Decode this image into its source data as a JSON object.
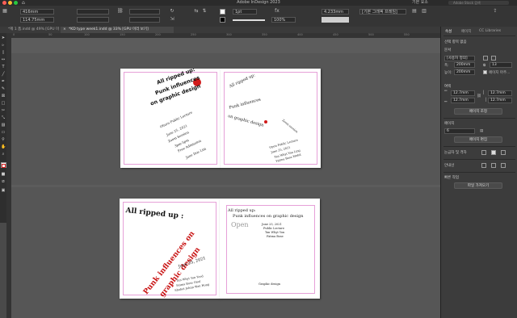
{
  "app": {
    "title": "Adobe InDesign 2023",
    "workspace": "기본 요소",
    "search_placeholder": "Adobe Stock 검색"
  },
  "controlbar": {
    "x_field": "416mm",
    "y_field": "114.75mm",
    "stroke_weight": "1pt",
    "opacity": "100%",
    "dimension": "4.233mm",
    "frame_style": "[기본 그래픽 프레임]"
  },
  "tabs": [
    {
      "label": "*제 1 폼.indd @ 49% [GPU 미리 보기]",
      "active": false
    },
    {
      "label": "*KD type week1.indd @ 33% [GPU 미리 보기]",
      "active": true
    }
  ],
  "ruler_ticks": [
    "0",
    "50",
    "100",
    "150",
    "200",
    "250",
    "300",
    "350",
    "400",
    "450",
    "500",
    "550"
  ],
  "panel": {
    "tabs": [
      "속성",
      "페이지",
      "CC Libraries"
    ],
    "no_selection": "선택 항목 없음",
    "document_section": "문서",
    "preset": "[사용자 정의]",
    "width_label": "폭:",
    "width_value": "200mm",
    "height_label": "높이:",
    "height_value": "200mm",
    "pages_count": "13",
    "facing_pages": "페이지 마주...",
    "margins_section": "여백",
    "margin_top": "12.7mm",
    "margin_bottom": "12.7mm",
    "margin_left": "12.7mm",
    "margin_right": "12.7mm",
    "margins_btn": "페이지 조정",
    "page_section": "페이지",
    "page_value": "6",
    "page_edit_btn": "페이지 편집",
    "rulers_section": "눈금자 및 격자",
    "guides_section": "안내선",
    "quick_actions": "빠른 작업",
    "import_btn": "파일 가져오기"
  },
  "page1": {
    "title_lines": [
      "All ripped up:",
      "Punk influences",
      "on graphic design"
    ],
    "info_lines": [
      "Ohuro Public Lecture",
      "June 25, 2021",
      "Zoom Session",
      "3pm-5pm",
      "Free Admission",
      "Jane Doe Lim"
    ],
    "small_lines": [
      "June 25",
      "2021",
      "Graphic design"
    ]
  },
  "page2": {
    "title_lines": [
      "All ripped up:",
      "Punk influences",
      "on graphic design"
    ],
    "small_lines": [
      "Zoom session",
      "Open Public Lecture",
      "June 25, 2021",
      "Tan Whyt Yon Ling",
      "Fatma Bose Mohd"
    ]
  },
  "page3": {
    "title": "All ripped up :",
    "red_lines": [
      "Punk influences on",
      "graphic design"
    ],
    "date": "June 25, 2021",
    "info_lines": [
      "Tan Whyt Yon Yeod",
      "Fatma Bose Onul",
      "Shohet Johnn Wan Hong"
    ]
  },
  "page4": {
    "top_line": "All ripped up:",
    "sub_line": "Punk influences on graphic design",
    "open_text": "Open",
    "info_lines": [
      "June 25, 2021",
      "Public Lecture",
      "Tan Whyt Yon",
      "Fatma Bose"
    ],
    "footer": "Graphic design"
  },
  "colors": {
    "accent_red": "#d11a1a",
    "margin_guide": "#e6a0d8",
    "panel_bg": "#3c3c3c"
  }
}
